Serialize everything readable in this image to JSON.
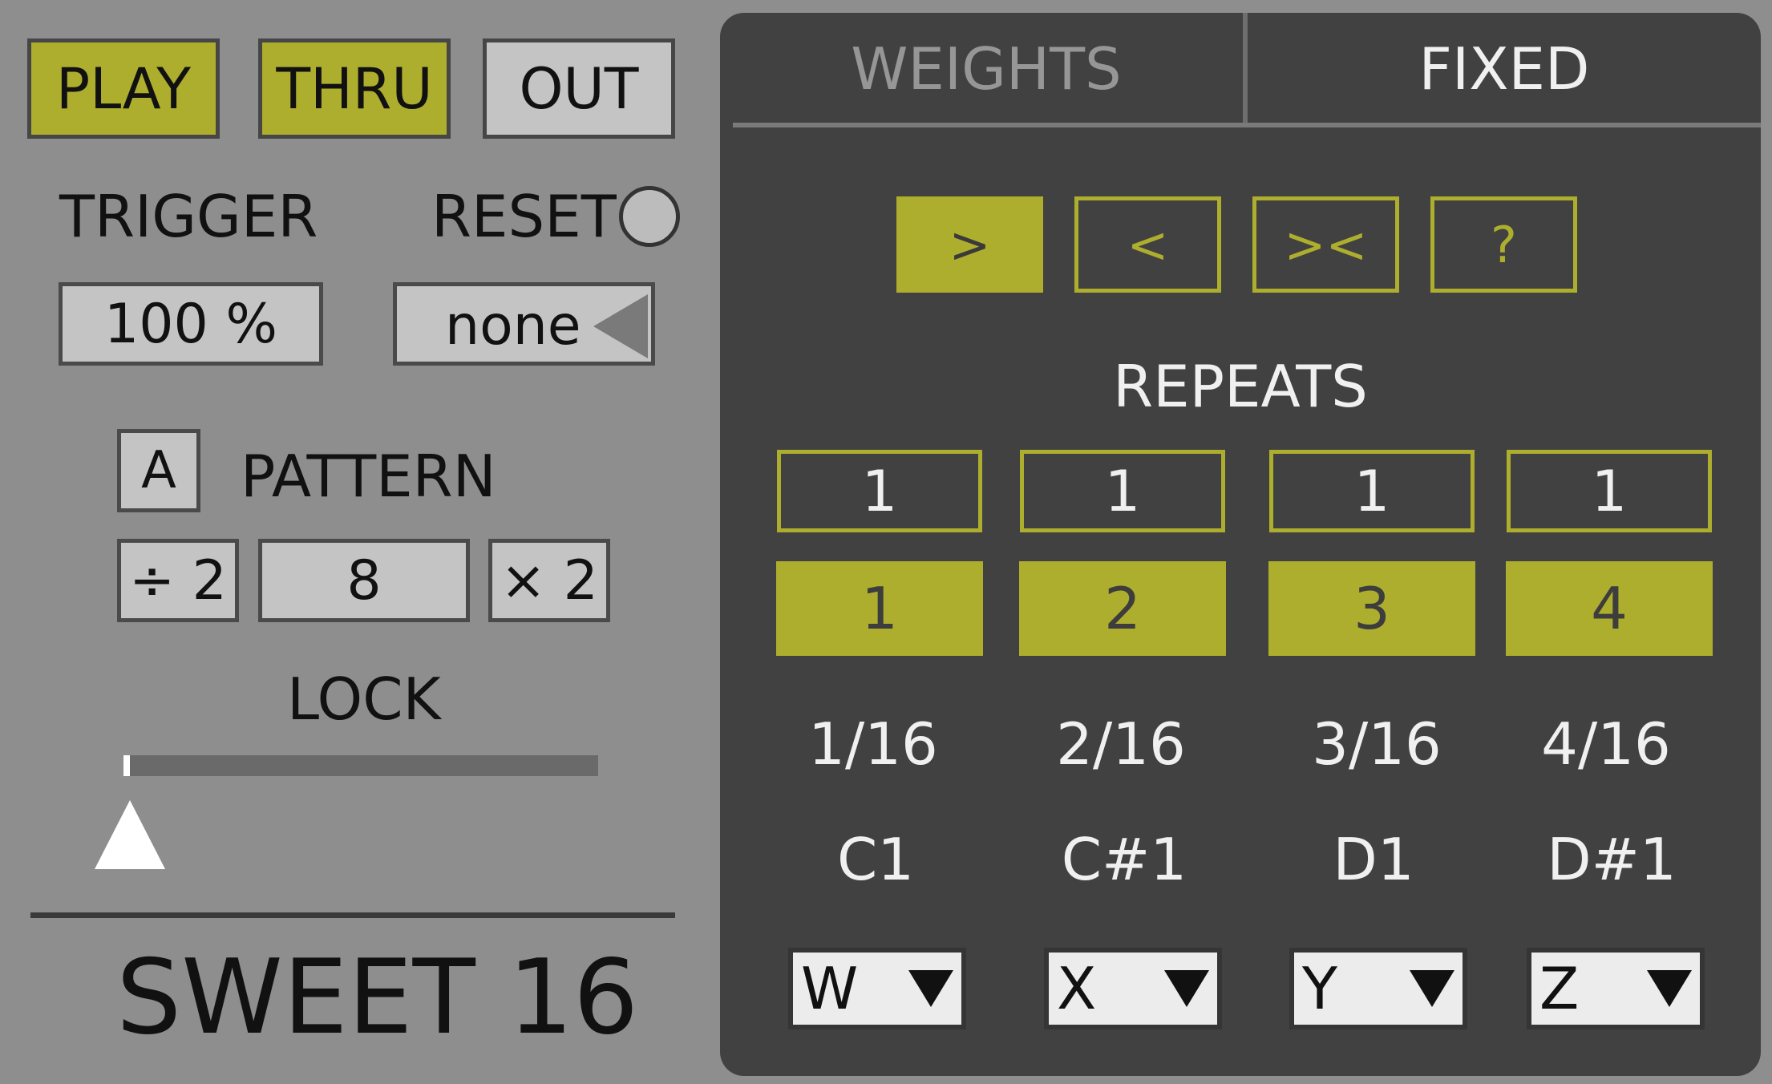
{
  "transport": {
    "play": "PLAY",
    "thru": "THRU",
    "out": "OUT"
  },
  "trigger": {
    "label": "TRIGGER",
    "value": "100 %"
  },
  "reset": {
    "label": "RESET",
    "value": "none"
  },
  "pattern": {
    "slot": "A",
    "label": "PATTERN",
    "halve": "÷ 2",
    "length": "8",
    "double": "× 2"
  },
  "lock": {
    "label": "LOCK",
    "value": 0
  },
  "device_name": "SWEET 16",
  "tabs": [
    {
      "label": "WEIGHTS"
    },
    {
      "label": "FIXED"
    }
  ],
  "directions": [
    ">",
    "<",
    "><",
    "?"
  ],
  "repeats": {
    "label": "REPEATS",
    "values": [
      "1",
      "1",
      "1",
      "1"
    ],
    "steps": [
      "1",
      "2",
      "3",
      "4"
    ],
    "durations": [
      "1/16",
      "2/16",
      "3/16",
      "4/16"
    ],
    "notes": [
      "C1",
      "C#1",
      "D1",
      "D#1"
    ],
    "outputs": [
      "W",
      "X",
      "Y",
      "Z"
    ]
  },
  "colors": {
    "accent": "#aeae2e",
    "panel": "#414141",
    "background": "#8e8e8e"
  }
}
